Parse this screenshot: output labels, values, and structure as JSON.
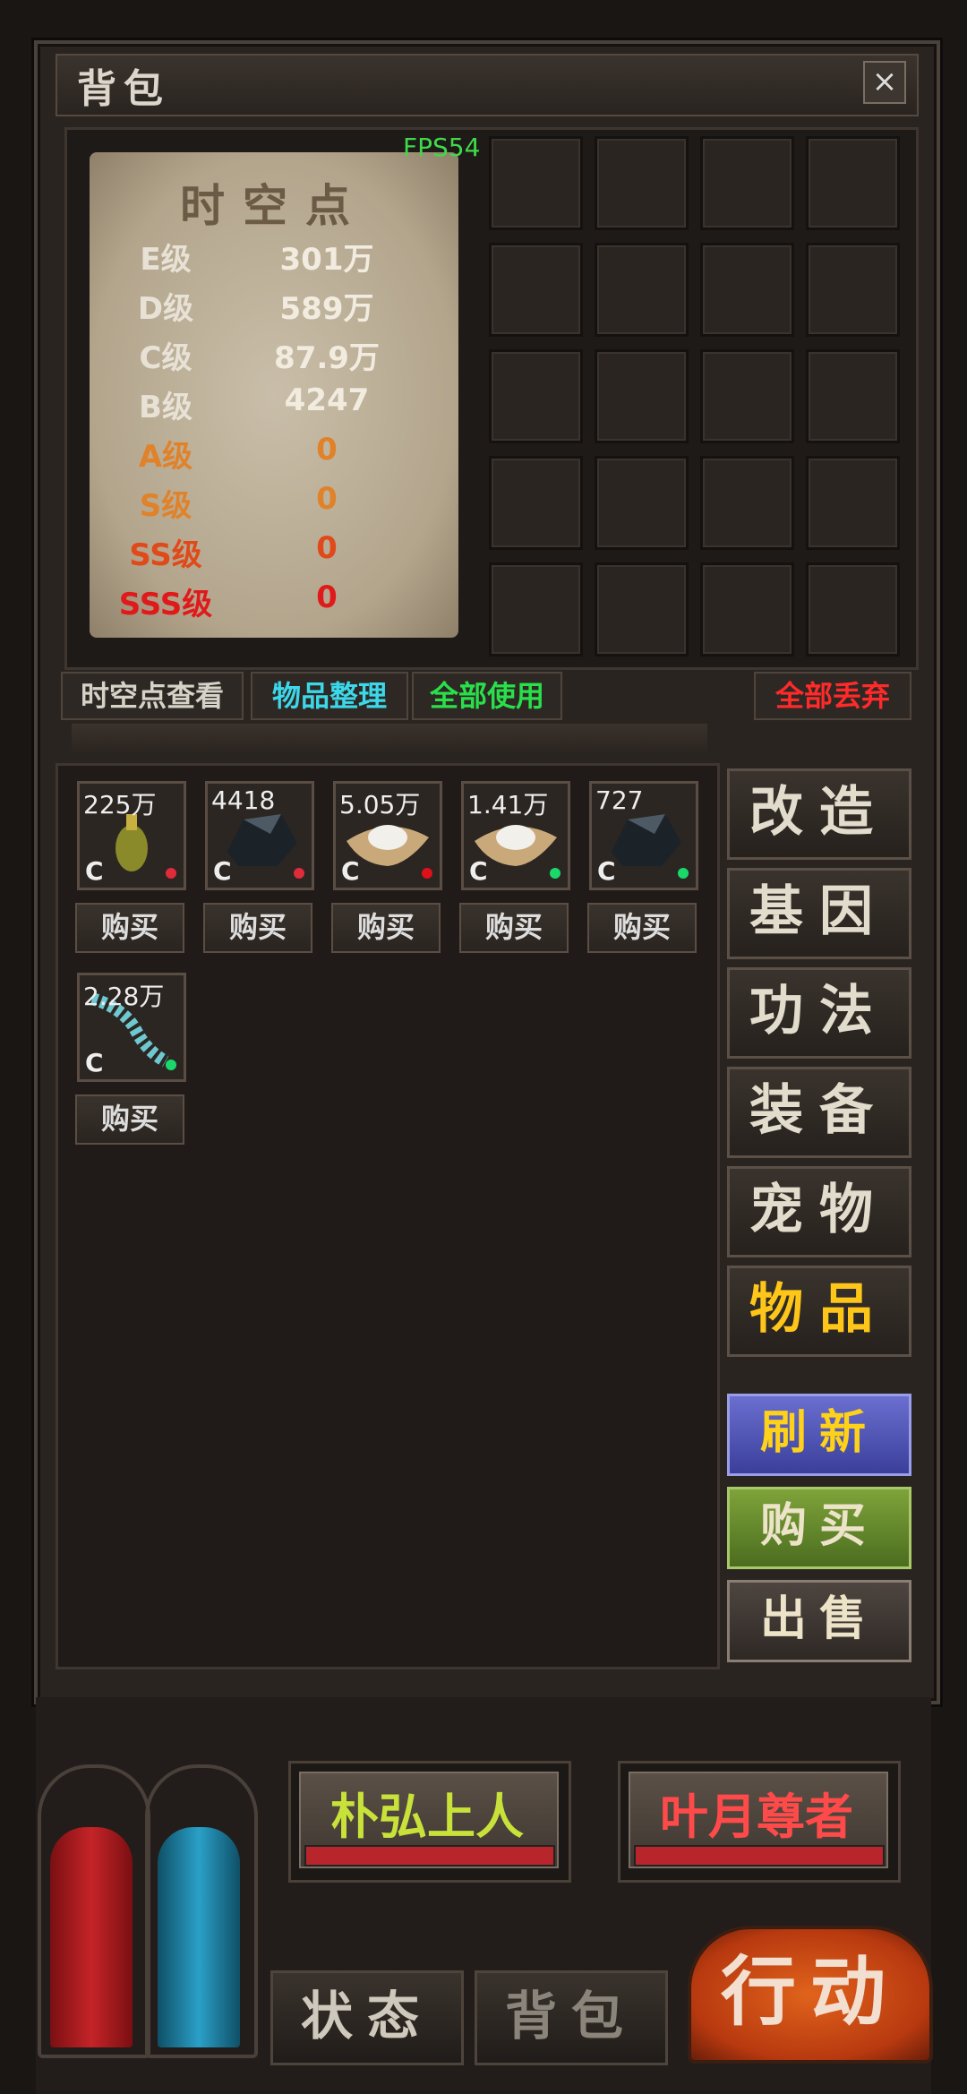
{
  "window": {
    "title": "背包",
    "close_glyph": "×"
  },
  "fps": "FPS54",
  "spacetime": {
    "title": "时空点",
    "rows": [
      {
        "grade": "E级",
        "value": "301万",
        "color": "#e8e2d6"
      },
      {
        "grade": "D级",
        "value": "589万",
        "color": "#e8e2d6"
      },
      {
        "grade": "C级",
        "value": "87.9万",
        "color": "#e8e2d6"
      },
      {
        "grade": "B级",
        "value": "4247",
        "color": "#e8e2d6"
      },
      {
        "grade": "A级",
        "value": "0",
        "color": "#e0822a"
      },
      {
        "grade": "S级",
        "value": "0",
        "color": "#e0822a"
      },
      {
        "grade": "SS级",
        "value": "0",
        "color": "#e04a1a"
      },
      {
        "grade": "SSS级",
        "value": "0",
        "color": "#e01a1a"
      }
    ]
  },
  "toolbar": {
    "view_label": "时空点查看",
    "sort_label": "物品整理",
    "use_all_label": "全部使用",
    "discard_all_label": "全部丢弃"
  },
  "market": {
    "items": [
      {
        "qty": "225万",
        "grade": "C",
        "icon": "potion-bottle-icon",
        "dot": "#e02b3a",
        "buy": "购买"
      },
      {
        "qty": "4418",
        "grade": "C",
        "icon": "ore-rock-icon",
        "dot": "#e02b3a",
        "buy": "购买"
      },
      {
        "qty": "5.05万",
        "grade": "C",
        "icon": "salt-powder-icon",
        "dot": "#e0101a",
        "buy": "购买"
      },
      {
        "qty": "1.41万",
        "grade": "C",
        "icon": "salt-powder-icon",
        "dot": "#19d96a",
        "buy": "购买"
      },
      {
        "qty": "727",
        "grade": "C",
        "icon": "ore-rock-icon",
        "dot": "#19d96a",
        "buy": "购买"
      },
      {
        "qty": "2.28万",
        "grade": "C",
        "icon": "bone-worm-icon",
        "dot": "#19d96a",
        "buy": "购买"
      }
    ]
  },
  "categories": [
    {
      "label": "改造",
      "active": false
    },
    {
      "label": "基因",
      "active": false
    },
    {
      "label": "功法",
      "active": false
    },
    {
      "label": "装备",
      "active": false
    },
    {
      "label": "宠物",
      "active": false
    },
    {
      "label": "物品",
      "active": true
    }
  ],
  "actions": {
    "refresh": "刷新",
    "buy": "购买",
    "sell": "出售"
  },
  "party": {
    "member1": {
      "name": "朴弘上人",
      "color": "#c8e23a"
    },
    "member2": {
      "name": "叶月尊者",
      "color": "#ff4a4a"
    }
  },
  "tabs": {
    "status": "状态",
    "bag": "背包"
  },
  "action_button": "行动",
  "colors": {
    "accent_gold": "#ffc61a",
    "hp_red": "#b8262b",
    "mp_blue": "#2aa0c8"
  }
}
